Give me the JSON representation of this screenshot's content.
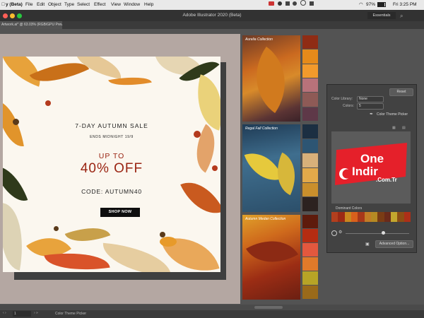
{
  "menubar": {
    "app_label": "y (Beta)",
    "items": [
      "File",
      "Edit",
      "Object",
      "Type",
      "Select",
      "Effect",
      "View",
      "Window",
      "Help"
    ],
    "battery": "97%",
    "clock": "Fri 3:25 PM"
  },
  "appbar": {
    "title": "Adobe Illustrator 2020 (Beta)",
    "workspace": "Essentials"
  },
  "document_tab": {
    "label": "Artwork.ai* @ 63.03% (RGB/GPU Preview)"
  },
  "artboard": {
    "headline": "7-DAY AUTUMN SALE",
    "subline": "ENDS MIDNIGHT 19/9",
    "offer_top": "UP TO",
    "offer_main": "40% OFF",
    "code": "CODE: AUTUMN40",
    "cta": "SHOP NOW"
  },
  "collections": [
    {
      "label": "Aurelia Collection",
      "swatches": [
        "#8f2c14",
        "#e58a1a",
        "#f29a2c",
        "#b8727a",
        "#8e5a56",
        "#5e3848"
      ]
    },
    {
      "label": "Regal Fall Collection",
      "swatches": [
        "#1c2f42",
        "#2d5573",
        "#d8b07a",
        "#e3a94a",
        "#ca8f2c",
        "#2c2220"
      ]
    },
    {
      "label": "Autumn Medan Collection",
      "swatches": [
        "#5e1b0c",
        "#b52c12",
        "#e3583e",
        "#e07a2a",
        "#b7a426",
        "#9a6a1a"
      ]
    }
  ],
  "panel": {
    "reset_label": "Reset",
    "color_library_label": "Color Library:",
    "color_library_value": "None",
    "colors_label": "Colors:",
    "colors_value": "5",
    "picker_label": "Color Theme Picker",
    "dominant_label": "Dominant Colors",
    "dominant_colors": [
      "#b33f1e",
      "#9c2a15",
      "#c9871f",
      "#d9601c",
      "#a8371a",
      "#c27c26",
      "#b58a23",
      "#7a3c14",
      "#6b2a1a",
      "#c3a62e",
      "#8d4e14",
      "#ad2f18"
    ],
    "advanced_label": "Advanced Option..."
  },
  "watermark": {
    "line1": "One",
    "line2": "Indir",
    "line3": ".Com.Tr"
  },
  "statusbar": {
    "zoom_value": "1",
    "tool_label": "Color Theme Picker"
  },
  "icons": [
    "apple-icon",
    "wifi-icon",
    "battery-icon",
    "search-icon",
    "eyedropper-icon",
    "settings-icon",
    "crescent-star-icon"
  ]
}
